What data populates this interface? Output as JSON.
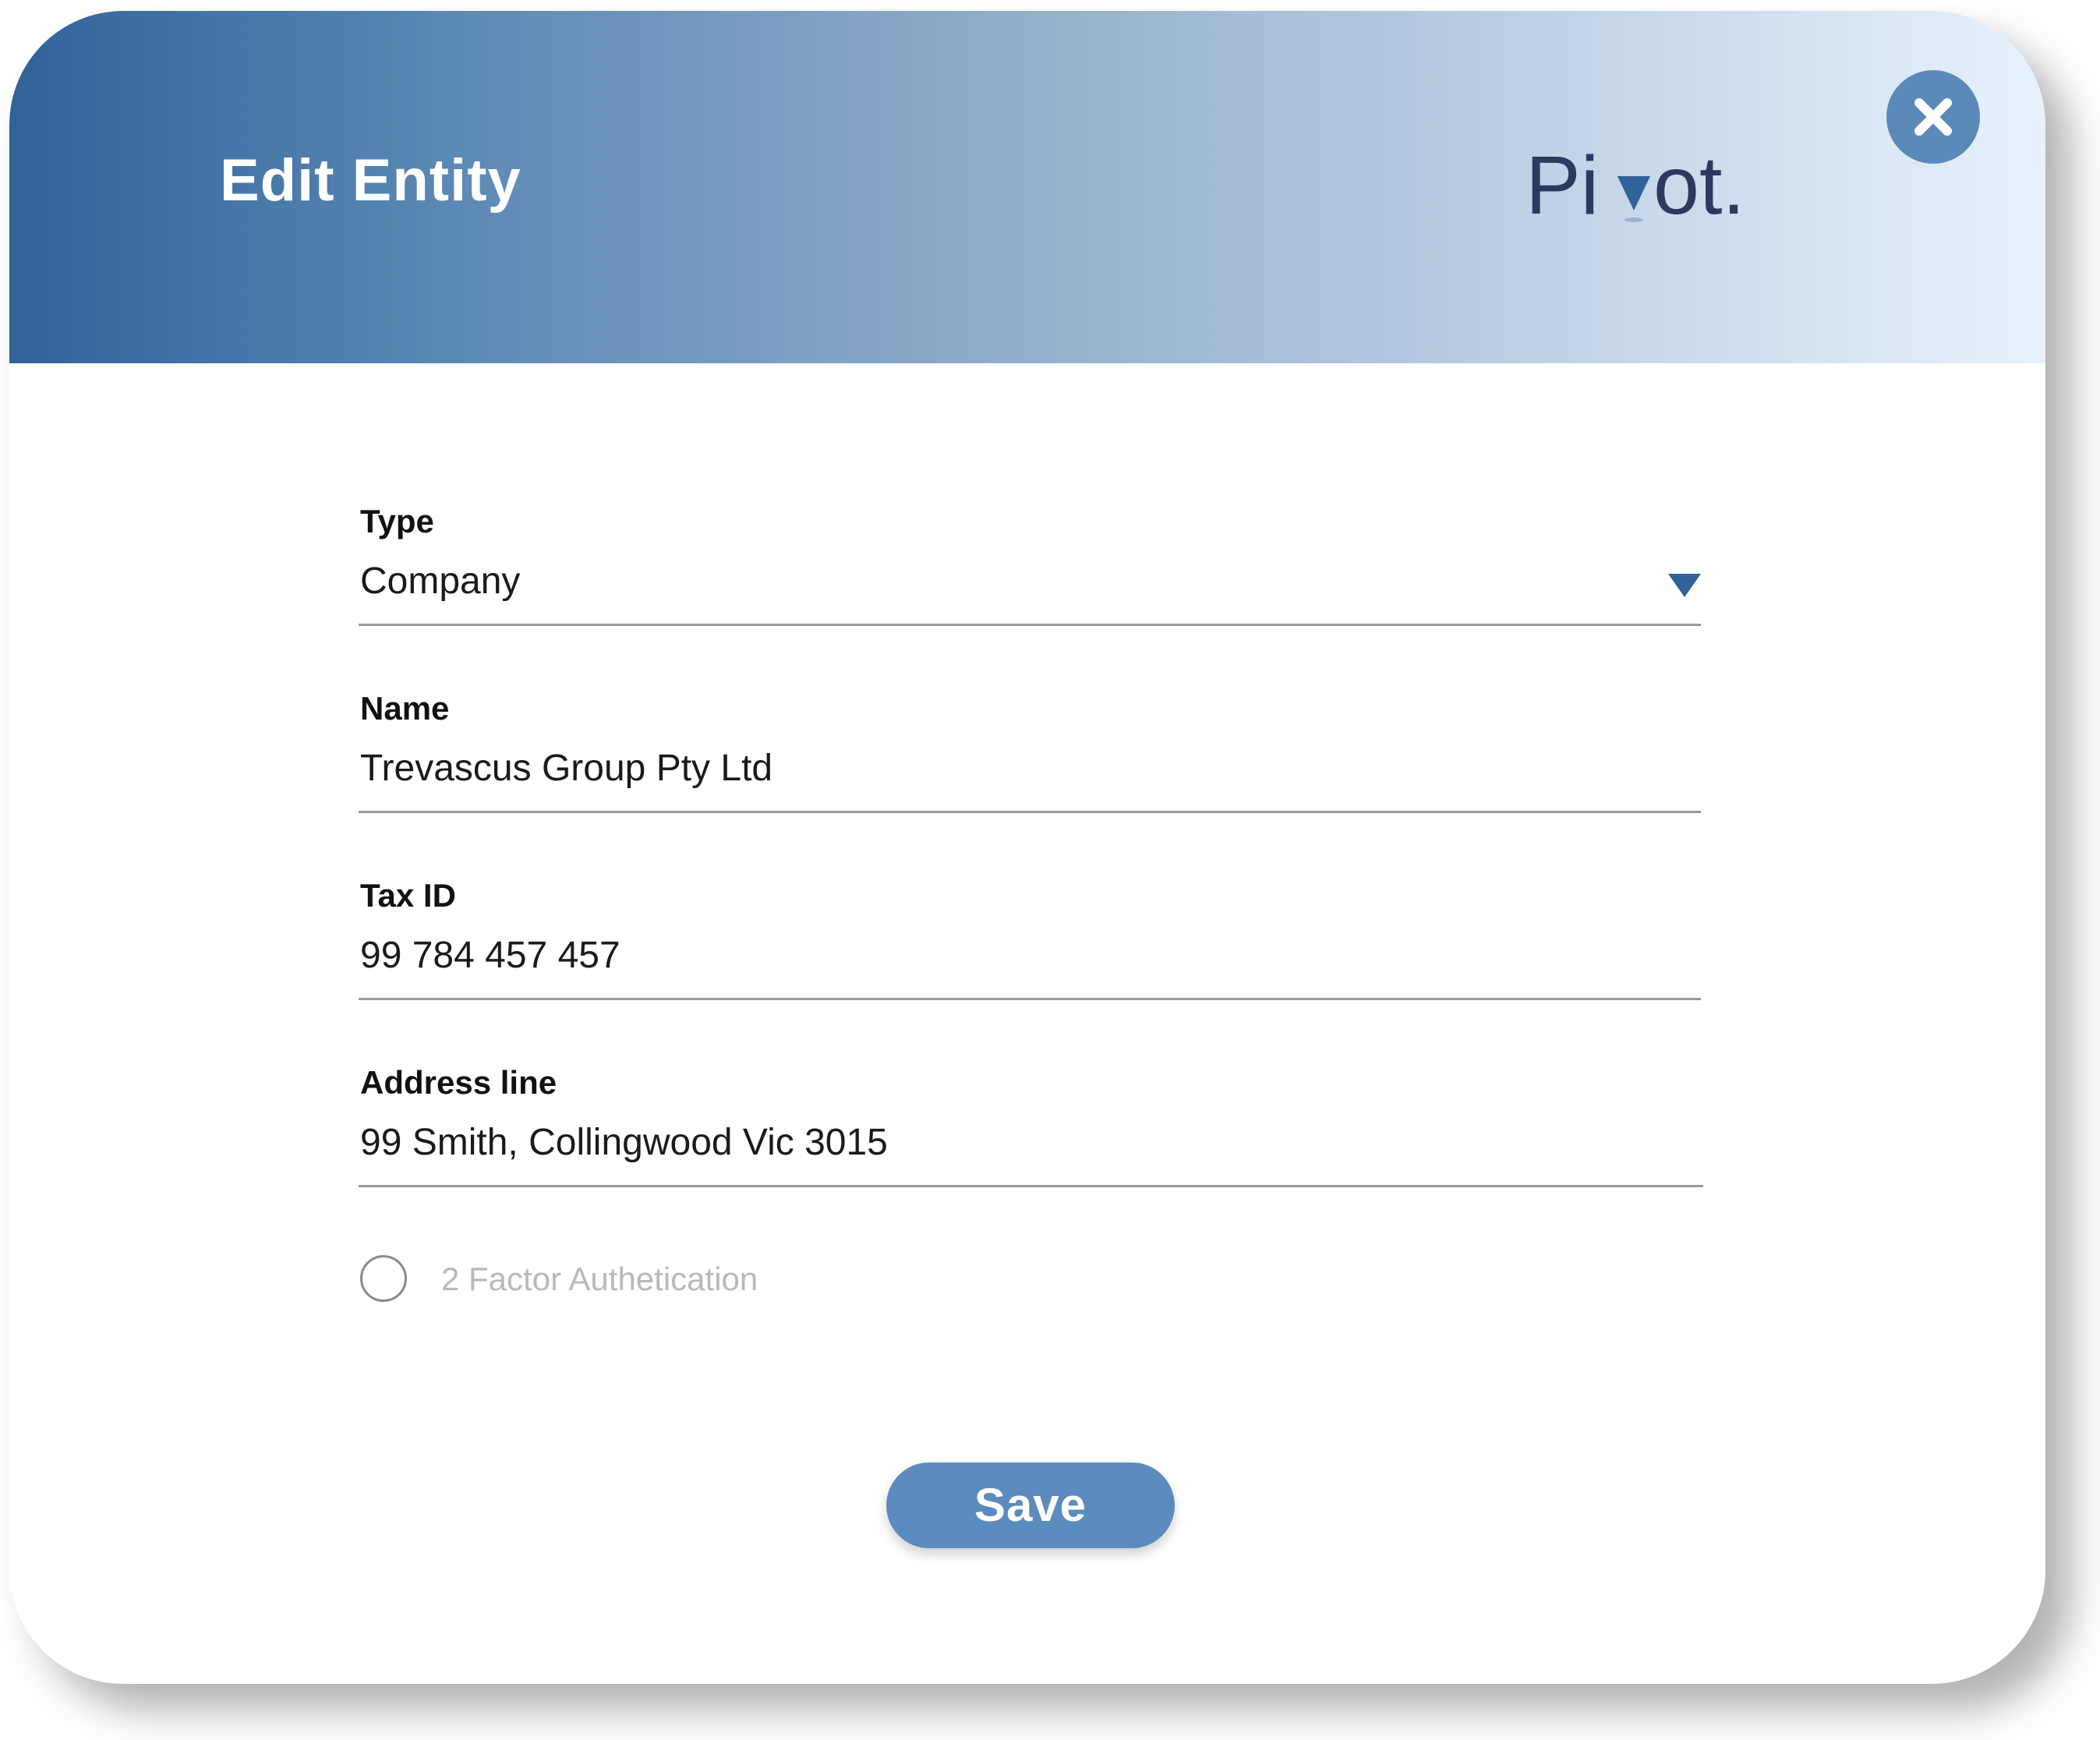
{
  "header": {
    "title": "Edit Entity",
    "logo_text": "Pivot."
  },
  "form": {
    "type": {
      "label": "Type",
      "value": "Company"
    },
    "name": {
      "label": "Name",
      "value": "Trevascus Group Pty Ltd"
    },
    "tax_id": {
      "label": "Tax ID",
      "value": "99 784 457 457"
    },
    "address": {
      "label": "Address line",
      "value": "99 Smith, Collingwood Vic 3015"
    },
    "two_factor": {
      "label": "2 Factor Authetication",
      "checked": false
    }
  },
  "actions": {
    "save_label": "Save"
  },
  "icons": {
    "close": "close-icon",
    "dropdown": "chevron-down-icon"
  },
  "colors": {
    "header_gradient_start": "#2f6399",
    "header_gradient_end": "#e8f2fc",
    "accent": "#5c8bbd",
    "logo_text": "#2b3a5e",
    "dropdown_arrow": "#2f6399"
  }
}
